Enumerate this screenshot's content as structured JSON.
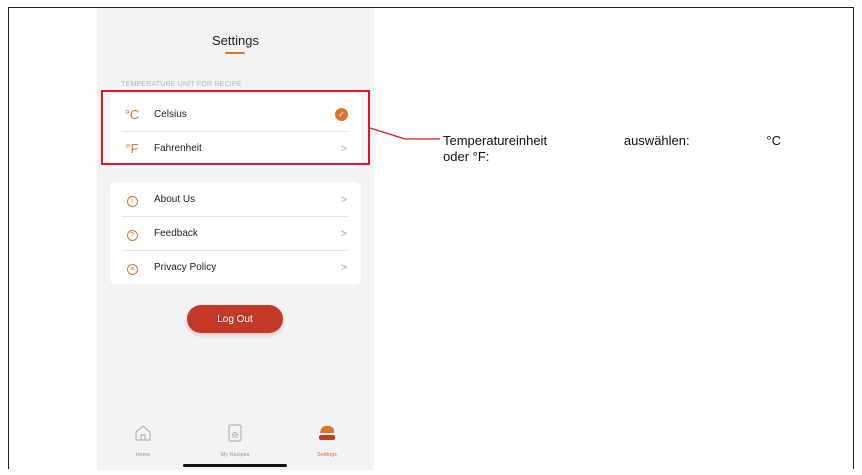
{
  "header": {
    "title": "Settings"
  },
  "temperature_section": {
    "header": "TEMPERATURE UNIT FOR RECIPE",
    "options": [
      {
        "symbol": "°C",
        "label": "Celsius",
        "selected": true
      },
      {
        "symbol": "°F",
        "label": "Fahrenheit",
        "selected": false
      }
    ]
  },
  "menu": {
    "items": [
      {
        "icon": "info-icon",
        "label": "About Us"
      },
      {
        "icon": "question-icon",
        "label": "Feedback"
      },
      {
        "icon": "document-icon",
        "label": "Privacy Policy"
      }
    ]
  },
  "logout_label": "Log Out",
  "tabbar": {
    "tabs": [
      {
        "icon": "home-icon",
        "label": "Home",
        "active": false
      },
      {
        "icon": "recipe-book-icon",
        "label": "My Recipes",
        "active": false
      },
      {
        "icon": "settings-chef-icon",
        "label": "Settings",
        "active": true
      }
    ]
  },
  "annotation": {
    "word1": "Temperatureinheit",
    "word2": "auswählen:",
    "word3": "°C",
    "line2": "oder °F:"
  },
  "colors": {
    "accent": "#d8742e",
    "logout": "#c23a27",
    "highlight": "#e0142a",
    "background": "#f3f3f5"
  }
}
